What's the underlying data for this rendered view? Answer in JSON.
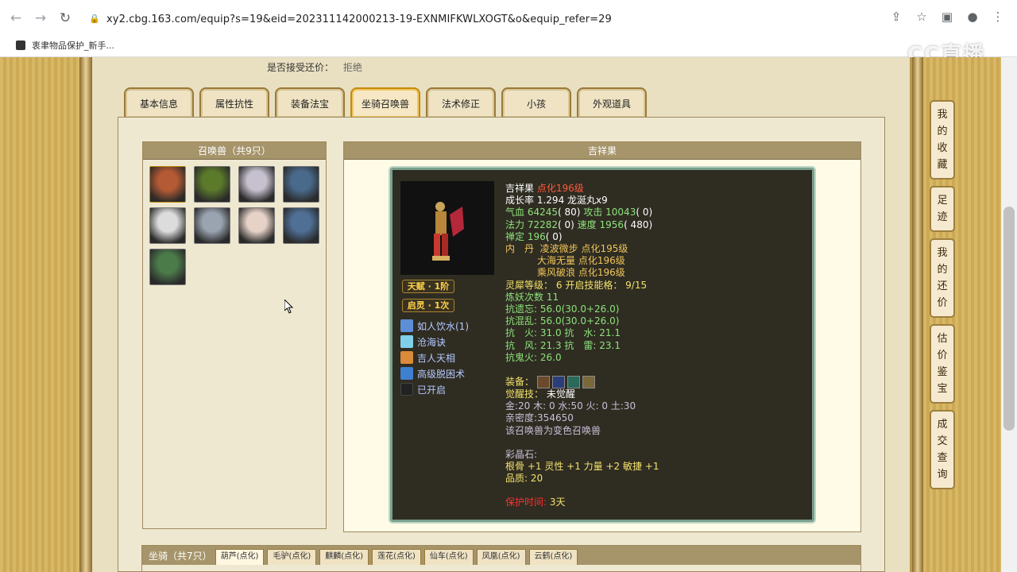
{
  "browser": {
    "url": "xy2.cbg.163.com/equip?s=19&eid=202311142000213-19-EXNMIFKWLXOGT&o&equip_refer=29",
    "bookmark": "衷聿物品保护_新手...",
    "watermark": "CC直播"
  },
  "accept_price": {
    "label": "是否接受还价：",
    "value": "拒绝"
  },
  "tabs": [
    "基本信息",
    "属性抗性",
    "装备法宝",
    "坐骑召唤兽",
    "法术修正",
    "小孩",
    "外观道具"
  ],
  "side_tabs": [
    [
      "我",
      "的",
      "收",
      "藏"
    ],
    [
      "足",
      "迹"
    ],
    [
      "我",
      "的",
      "还",
      "价"
    ],
    [
      "估",
      "价",
      "鉴",
      "宝"
    ],
    [
      "成",
      "交",
      "查",
      "询"
    ]
  ],
  "pets_box": {
    "title": "召唤兽（共9只）",
    "count": 9
  },
  "pet_detail": {
    "title": "吉祥果",
    "badge1": "天赋 · 1阶",
    "badge2": "启灵 · 1次",
    "skills": [
      "如人饮水(1)",
      "沧海诀",
      "吉人天相",
      "高级脱困术",
      "已开启"
    ],
    "name": "吉祥果",
    "name_tag": "点化196级",
    "growth_label": "成长率",
    "growth": "1.294",
    "growth_extra": "龙涎丸x9",
    "hp_label": "气血",
    "hp": "64245",
    "hp_p": "( 80)",
    "atk_label": "攻击",
    "atk": "10043",
    "atk_p": "( 0)",
    "mp_label": "法力",
    "mp": "72282",
    "mp_p": "( 0)",
    "spd_label": "速度",
    "spd": "1956",
    "spd_p": "( 480)",
    "def_label": "禅定",
    "def": "196",
    "def_p": "( 0)",
    "neidan_label": "内　丹",
    "neidan": [
      "凌波微步 点化195级",
      "大海无量 点化196级",
      "乘风破浪 点化196级"
    ],
    "lingxi_label": "灵犀等级：",
    "lingxi": "6",
    "skill_label": "开启技能格：",
    "skill_slots": "9/15",
    "yaolian_label": "炼妖次数",
    "yaolian": "11",
    "kang1": "抗遗忘: 56.0(30.0+26.0)",
    "kang2": "抗混乱: 56.0(30.0+26.0)",
    "kang3": "抗　火: 31.0 抗　水: 21.1",
    "kang4": "抗　风: 21.3 抗　雷: 23.1",
    "kang5": "抗鬼火: 26.0",
    "equip_label": "装备：",
    "awaken_label": "觉醒技：",
    "awaken": "未觉醒",
    "wuxing": "金:20 木: 0 水:50 火: 0 土:30",
    "intimacy": "亲密度:354650",
    "variant": "该召唤兽为变色召唤兽",
    "crystal_label": "彩晶石:",
    "crystal": "根骨 +1 灵性 +1 力量 +2 敏捷 +1",
    "quality": "品质: 20",
    "protect_label": "保护时间:",
    "protect": "3天"
  },
  "mounts": {
    "title": "坐骑（共7只）",
    "tabs": [
      "葫芦(点化)",
      "毛驴(点化)",
      "麒麟(点化)",
      "莲花(点化)",
      "仙车(点化)",
      "凤凰(点化)",
      "云鹤(点化)"
    ]
  },
  "colors": {
    "accent": "#c58a0c",
    "panel_head": "#a6946a",
    "detail_bg": "#2f2c22"
  },
  "pet_colors": [
    "#b45a34",
    "#5b7a2a",
    "#c7c1cf",
    "#4a6a8c",
    "#dcdcdc",
    "#9aa3b0",
    "#e6d2c7",
    "#4f6f95",
    "#4c7b4a"
  ]
}
